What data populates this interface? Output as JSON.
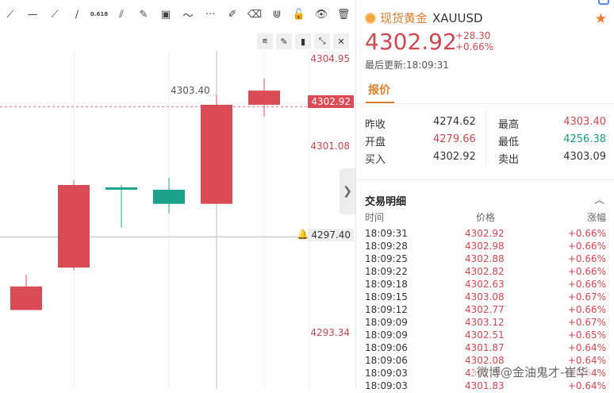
{
  "toolbar": {
    "tools": [
      {
        "name": "ray-tool-icon",
        "glyph": "⟋"
      },
      {
        "name": "horizontal-line-icon",
        "glyph": "—"
      },
      {
        "name": "trend-line-icon",
        "glyph": "⟋"
      },
      {
        "name": "pencil-line-icon",
        "glyph": "∕"
      },
      {
        "name": "fib-retracement-icon",
        "glyph": "0.618"
      },
      {
        "name": "fan-icon",
        "glyph": "⫽"
      },
      {
        "name": "brush-icon",
        "glyph": "✎"
      },
      {
        "name": "image-icon",
        "glyph": "▣"
      },
      {
        "name": "wave-icon",
        "glyph": "〜"
      },
      {
        "name": "more-icon",
        "glyph": "···"
      },
      {
        "name": "edit-icon",
        "glyph": "✐"
      },
      {
        "name": "eraser-icon",
        "glyph": "⌫"
      },
      {
        "name": "magnet-icon",
        "glyph": "⋓"
      },
      {
        "name": "lock-icon",
        "glyph": "🔓"
      },
      {
        "name": "eye-icon",
        "glyph": "👁"
      },
      {
        "name": "trash-icon",
        "glyph": "🗑"
      }
    ]
  },
  "subtoolbar": [
    {
      "name": "line-style-icon",
      "glyph": "⩳"
    },
    {
      "name": "pen-icon",
      "glyph": "✎"
    },
    {
      "name": "candle-type-icon",
      "glyph": "▮"
    },
    {
      "name": "collapse-icon",
      "glyph": "⤡"
    },
    {
      "name": "close-icon",
      "glyph": "✕"
    }
  ],
  "chart": {
    "y_labels": [
      "4304.95",
      "4301.08",
      "4293.34"
    ],
    "current_price_tag": "4302.92",
    "crosshair_price_tag": "4297.40",
    "high_annotation": "4303.40",
    "colors": {
      "up": "#d94b55",
      "down": "#1aa38a"
    }
  },
  "chart_data": {
    "type": "candlestick",
    "ylim": [
      4291.5,
      4306.5
    ],
    "candles": [
      {
        "open": 4294.3,
        "close": 4295.3,
        "high": 4295.8,
        "low": 4294.3
      },
      {
        "open": 4296.1,
        "close": 4299.6,
        "high": 4299.8,
        "low": 4296.0
      },
      {
        "open": 4299.5,
        "close": 4299.4,
        "high": 4299.6,
        "low": 4297.8
      },
      {
        "open": 4299.4,
        "close": 4298.8,
        "high": 4299.9,
        "low": 4298.4
      },
      {
        "open": 4298.8,
        "close": 4303.0,
        "high": 4303.4,
        "low": 4298.8
      },
      {
        "open": 4303.0,
        "close": 4303.6,
        "high": 4304.1,
        "low": 4302.5
      }
    ]
  },
  "quote": {
    "name_cn": "现货黄金",
    "symbol": "XAUUSD",
    "price": "4302.92",
    "change": "+28.30",
    "change_pct": "+0.66%",
    "updated": "最后更新:18:09:31",
    "tab": "报价",
    "fields": [
      {
        "label": "昨收",
        "value": "4274.62",
        "color": "dark"
      },
      {
        "label": "最高",
        "value": "4303.40",
        "color": "red"
      },
      {
        "label": "开盘",
        "value": "4279.66",
        "color": "red"
      },
      {
        "label": "最低",
        "value": "4256.38",
        "color": "green"
      },
      {
        "label": "买入",
        "value": "4302.92",
        "color": "dark"
      },
      {
        "label": "卖出",
        "value": "4303.09",
        "color": "dark"
      }
    ]
  },
  "trades": {
    "title": "交易明细",
    "headers": {
      "time": "时间",
      "price": "价格",
      "change": "涨幅"
    },
    "rows": [
      {
        "time": "18:09:31",
        "price": "4302.92",
        "change": "+0.66%"
      },
      {
        "time": "18:09:28",
        "price": "4302.98",
        "change": "+0.66%"
      },
      {
        "time": "18:09:25",
        "price": "4302.88",
        "change": "+0.66%"
      },
      {
        "time": "18:09:22",
        "price": "4302.82",
        "change": "+0.66%"
      },
      {
        "time": "18:09:18",
        "price": "4302.63",
        "change": "+0.66%"
      },
      {
        "time": "18:09:15",
        "price": "4303.08",
        "change": "+0.67%"
      },
      {
        "time": "18:09:12",
        "price": "4302.77",
        "change": "+0.66%"
      },
      {
        "time": "18:09:09",
        "price": "4303.12",
        "change": "+0.67%"
      },
      {
        "time": "18:09:09",
        "price": "4302.51",
        "change": "+0.65%"
      },
      {
        "time": "18:09:06",
        "price": "4301.87",
        "change": "+0.64%"
      },
      {
        "time": "18:09:06",
        "price": "4302.08",
        "change": "+0.64%"
      },
      {
        "time": "18:09:03",
        "price": "4302.0",
        "change": "+0.64%"
      },
      {
        "time": "18:09:03",
        "price": "4301.83",
        "change": "+0.64%"
      }
    ]
  },
  "watermark": "微博@金油鬼才-崔华"
}
